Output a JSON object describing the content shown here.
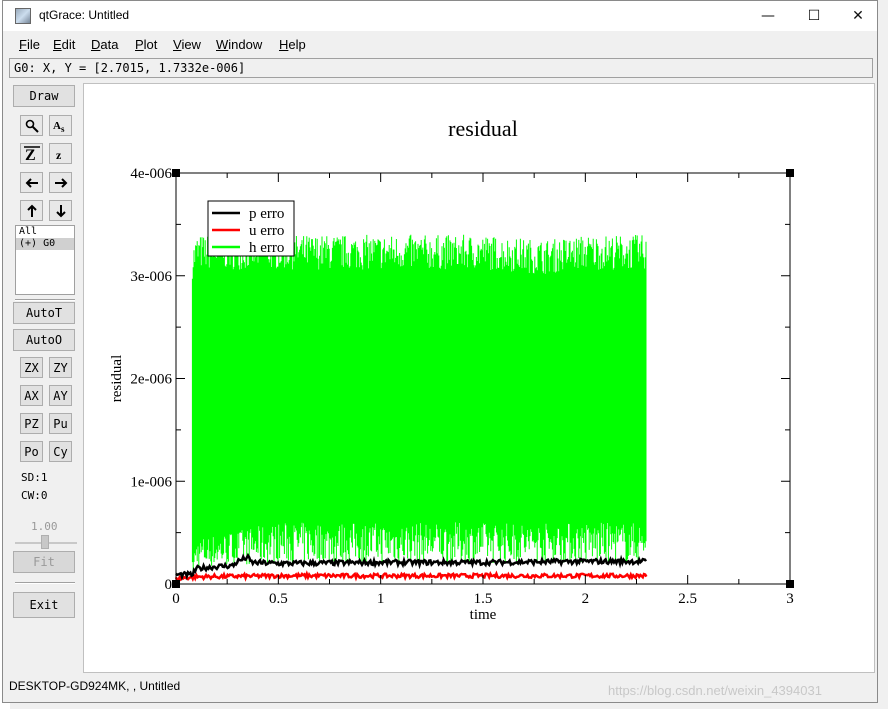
{
  "window": {
    "title": "qtGrace: Untitled",
    "minimize": "—",
    "maximize": "☐",
    "close": "✕"
  },
  "menu": [
    "File",
    "Edit",
    "Data",
    "Plot",
    "View",
    "Window",
    "Help"
  ],
  "menu_access_keys": [
    "F",
    "E",
    "D",
    "P",
    "V",
    "W",
    "H"
  ],
  "locator": "G0: X, Y = [2.7015, 1.7332e-006]",
  "toolbar": {
    "draw": "Draw",
    "sets": [
      "All",
      "(+) G0"
    ],
    "autot": "AutoT",
    "autoo": "AutoO",
    "grid_buttons": [
      "ZX",
      "ZY",
      "AX",
      "AY",
      "PZ",
      "Pu",
      "Po",
      "Cy"
    ],
    "sd": "SD:1",
    "cw": "CW:0",
    "zoom_value": "1.00",
    "fit": "Fit",
    "exit": "Exit"
  },
  "status": "DESKTOP-GD924MK, , Untitled",
  "watermark": "https://blog.csdn.net/weixin_4394031",
  "chart_data": {
    "type": "line",
    "title": "residual",
    "xlabel": "time",
    "ylabel": "residual",
    "xlim": [
      0,
      3
    ],
    "ylim": [
      0,
      4e-06
    ],
    "x_ticks": [
      "0",
      "0.5",
      "1",
      "1.5",
      "2",
      "2.5",
      "3"
    ],
    "y_ticks": [
      "0",
      "1e-006",
      "2e-006",
      "3e-006",
      "4e-006"
    ],
    "legend_position": "top-left",
    "grid": false,
    "series": [
      {
        "name": "p erro",
        "color": "#000000",
        "x": [
          0,
          0.02,
          0.08,
          0.1,
          0.2,
          0.28,
          0.3,
          0.35,
          0.37,
          0.5,
          1.0,
          1.5,
          2.0,
          2.3
        ],
        "y": [
          9e-08,
          9e-08,
          9e-08,
          1.5e-07,
          1.7e-07,
          1.8e-07,
          2.2e-07,
          2.6e-07,
          2.1e-07,
          2e-07,
          2.1e-07,
          2.1e-07,
          2.2e-07,
          2.2e-07
        ]
      },
      {
        "name": "u erro",
        "color": "#ff0000",
        "x": [
          0,
          0.1,
          0.5,
          1.0,
          1.5,
          2.0,
          2.3
        ],
        "y": [
          5e-08,
          7e-08,
          8e-08,
          8e-08,
          8e-08,
          8e-08,
          8e-08
        ]
      },
      {
        "name": "h erro",
        "color": "#00ff00",
        "x": [
          0.08,
          0.1,
          0.5,
          1.0,
          1.5,
          1.8,
          2.0,
          2.1,
          2.2,
          2.3
        ],
        "y_low": [
          1.5e-07,
          3e-07,
          4e-07,
          4e-07,
          4e-07,
          4e-07,
          4e-07,
          4e-07,
          4e-07,
          4e-07
        ],
        "y_high": [
          3.3e-06,
          3.4e-06,
          3.4e-06,
          3.4e-06,
          3.4e-06,
          3.35e-06,
          3.4e-06,
          3.4e-06,
          3.4e-06,
          3.4e-06
        ]
      }
    ]
  }
}
